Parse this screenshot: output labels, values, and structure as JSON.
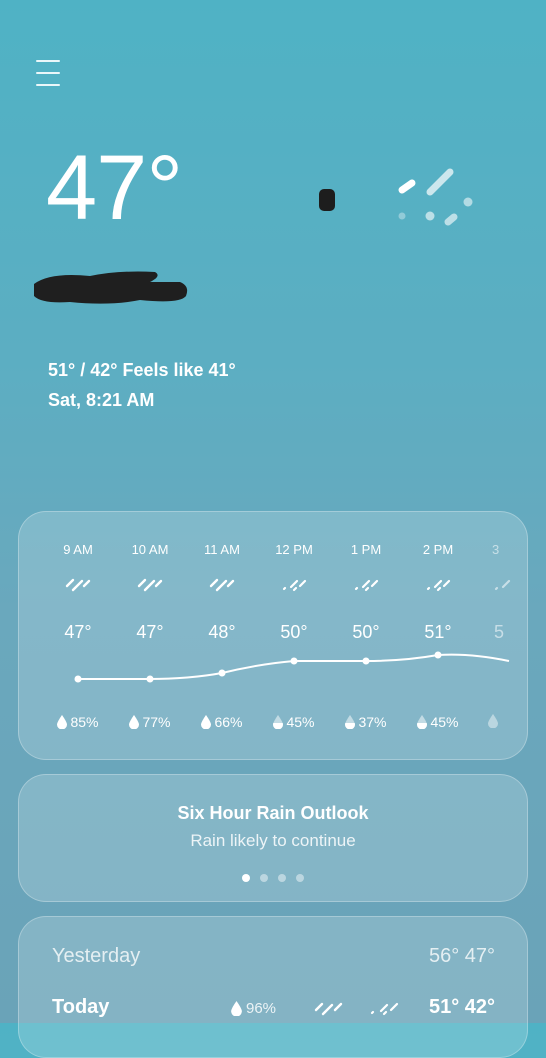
{
  "current": {
    "temperature": "47°",
    "hi_lo_feels": "51° / 42° Feels like 41°",
    "datetime": "Sat, 8:21 AM"
  },
  "hourly": [
    {
      "time": "9 AM",
      "temp": "47°",
      "precip": "85%",
      "icon": "rain-icon"
    },
    {
      "time": "10 AM",
      "temp": "47°",
      "precip": "77%",
      "icon": "rain-icon"
    },
    {
      "time": "11 AM",
      "temp": "48°",
      "precip": "66%",
      "icon": "rain-icon"
    },
    {
      "time": "12 PM",
      "temp": "50°",
      "precip": "45%",
      "icon": "light-rain-icon"
    },
    {
      "time": "1 PM",
      "temp": "50°",
      "precip": "37%",
      "icon": "light-rain-icon"
    },
    {
      "time": "2 PM",
      "temp": "51°",
      "precip": "45%",
      "icon": "light-rain-icon"
    },
    {
      "time": "3",
      "temp": "5",
      "precip": "",
      "icon": "light-rain-icon"
    }
  ],
  "rain_outlook": {
    "title": "Six Hour Rain Outlook",
    "subtitle": "Rain likely to continue",
    "pages": 4,
    "active_page": 1
  },
  "daily": [
    {
      "day": "Yesterday",
      "temps": "56° 47°"
    },
    {
      "day": "Today",
      "precip": "96%",
      "temps": "51° 42°"
    }
  ],
  "colors": {
    "background_top": "#4fb2c5",
    "background_bottom": "#6aa3b8",
    "card": "rgba(255,255,255,0.18)",
    "text": "#ffffff"
  }
}
